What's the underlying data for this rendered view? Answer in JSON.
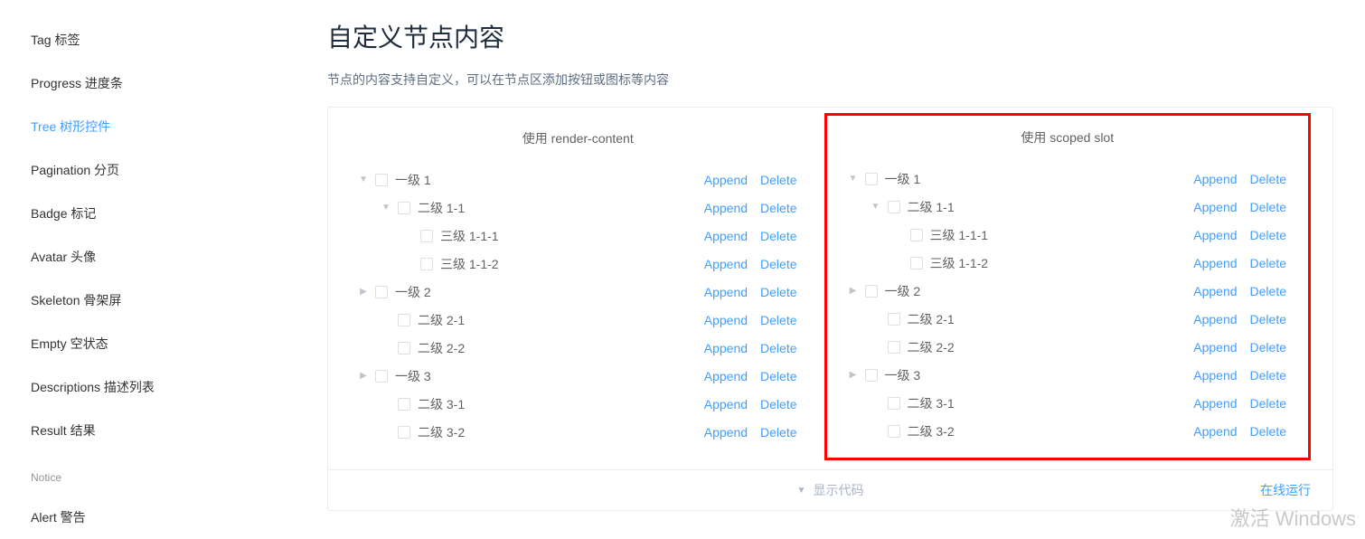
{
  "sidebar": {
    "items": [
      {
        "label": "Tag 标签",
        "active": false
      },
      {
        "label": "Progress 进度条",
        "active": false
      },
      {
        "label": "Tree 树形控件",
        "active": true
      },
      {
        "label": "Pagination 分页",
        "active": false
      },
      {
        "label": "Badge 标记",
        "active": false
      },
      {
        "label": "Avatar 头像",
        "active": false
      },
      {
        "label": "Skeleton 骨架屏",
        "active": false
      },
      {
        "label": "Empty 空状态",
        "active": false
      },
      {
        "label": "Descriptions 描述列表",
        "active": false
      },
      {
        "label": "Result 结果",
        "active": false
      }
    ],
    "group": "Notice",
    "groupItems": [
      {
        "label": "Alert 警告",
        "active": false
      }
    ]
  },
  "section": {
    "title": "自定义节点内容",
    "desc": "节点的内容支持自定义，可以在节点区添加按钮或图标等内容"
  },
  "trees": {
    "left_title": "使用 render-content",
    "right_title": "使用 scoped slot",
    "actions": {
      "append": "Append",
      "delete": "Delete"
    },
    "nodes": [
      {
        "level": 0,
        "expand": "open",
        "label": "一级 1"
      },
      {
        "level": 1,
        "expand": "open",
        "label": "二级 1-1"
      },
      {
        "level": 2,
        "expand": "none",
        "label": "三级 1-1-1"
      },
      {
        "level": 2,
        "expand": "none",
        "label": "三级 1-1-2"
      },
      {
        "level": 0,
        "expand": "closed",
        "label": "一级 2"
      },
      {
        "level": 1,
        "expand": "none",
        "label": "二级 2-1"
      },
      {
        "level": 1,
        "expand": "none",
        "label": "二级 2-2"
      },
      {
        "level": 0,
        "expand": "closed",
        "label": "一级 3"
      },
      {
        "level": 1,
        "expand": "none",
        "label": "二级 3-1"
      },
      {
        "level": 1,
        "expand": "none",
        "label": "二级 3-2"
      }
    ]
  },
  "footer": {
    "showCode": "显示代码",
    "onlineRun": "在线运行"
  },
  "watermark": "激活 Windows"
}
